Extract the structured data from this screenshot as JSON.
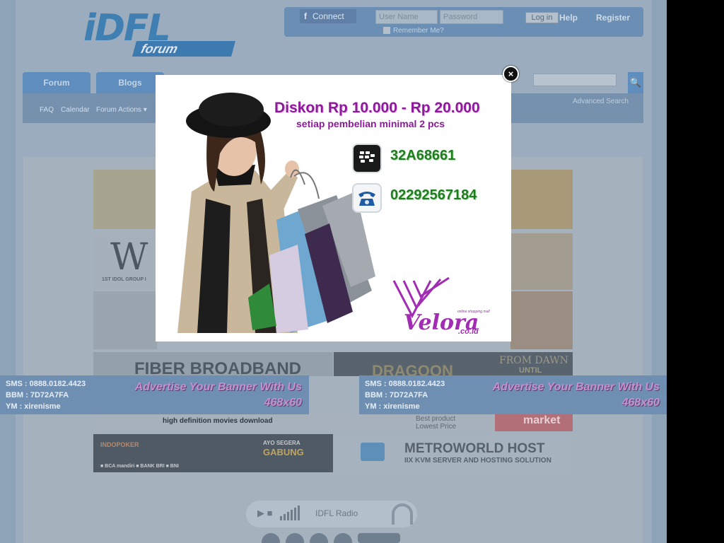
{
  "header": {
    "logo_main": "iDFL",
    "logo_sub": "forum",
    "connect_label": "Connect",
    "username_placeholder": "User Name",
    "password_placeholder": "Password",
    "login_label": "Log in",
    "help_label": "Help",
    "register_label": "Register",
    "remember_label": "Remember Me?"
  },
  "nav": {
    "tabs": [
      "Forum",
      "Blogs"
    ],
    "sub_items": [
      "FAQ",
      "Calendar",
      "Forum Actions ▾"
    ],
    "advanced_search": "Advanced Search",
    "search_icon": "🔍"
  },
  "banners": {
    "wfl_letter": "W",
    "wfl_tag": "1ST IDOL GROUP I",
    "fiber": "FIBER BROADBAND",
    "dragon": "DRAGOON",
    "from_dawn": "FROM DAWN",
    "until": "UNTIL",
    "hd_movies": "high definition movies download",
    "best_product": "Best product",
    "lowest_price": "Lowest Price",
    "market": "market",
    "ayo": "AYO SEGERA",
    "gabung": "GABUNG",
    "bank_row": "■ BCA  mandiri  ■ BANK BRI  ■ BNI",
    "metroworld": "METROWORLD HOST",
    "metroworld_sub": "IIX KVM SERVER AND HOSTING SOLUTION",
    "indo": "INDOPOKER"
  },
  "ads": [
    {
      "sms": "SMS : 0888.0182.4423",
      "bbm": "BBM : 7D72A7FA",
      "ym": "YM : xirenisme",
      "headline": "Advertise Your Banner With Us",
      "size": "468x60"
    },
    {
      "sms": "SMS : 0888.0182.4423",
      "bbm": "BBM : 7D72A7FA",
      "ym": "YM : xirenisme",
      "headline": "Advertise Your Banner With Us",
      "size": "468x60"
    }
  ],
  "radio": {
    "label": "IDFL Radio",
    "play_icon": "▶ ■"
  },
  "popup": {
    "headline": "Diskon Rp 10.000 - Rp 20.000",
    "subline": "setiap pembelian minimal 2 pcs",
    "bbm_pin": "32A68661",
    "phone": "02292567184",
    "brand": "Velora",
    "brand_tld": ".co.id",
    "brand_tagline": "online shopping mall",
    "close_glyph": "×",
    "accent": "#8d1a9a",
    "contact_color": "#1e7e1e"
  }
}
